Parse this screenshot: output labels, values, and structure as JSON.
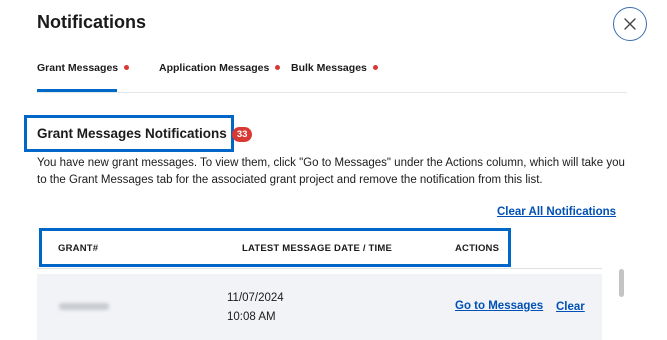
{
  "header": {
    "title": "Notifications"
  },
  "tabs": [
    {
      "label": "Grant Messages",
      "active": true
    },
    {
      "label": "Application Messages",
      "active": false
    },
    {
      "label": "Bulk Messages",
      "active": false
    }
  ],
  "section": {
    "title": "Grant Messages Notifications",
    "count": "33",
    "description": "You have new grant messages. To view them, click \"Go to Messages\" under the Actions column, which will take you to the Grant Messages tab for the associated grant project and remove the notification from this list."
  },
  "actions": {
    "clear_all_label": "Clear All Notifications"
  },
  "table": {
    "columns": [
      "GRANT#",
      "LATEST MESSAGE DATE / TIME",
      "ACTIONS"
    ],
    "rows": [
      {
        "grant": "",
        "date": "11/07/2024",
        "time": "10:08 AM",
        "go_label": "Go to Messages",
        "clear_label": "Clear"
      }
    ]
  },
  "colors": {
    "accent": "#0050b5",
    "highlight_box": "#0066c7",
    "badge": "#d83933",
    "row_bg": "#f1f3f6"
  },
  "icons": {
    "close": "close-icon (x in circle)",
    "notification_dot": "red-dot-icon"
  }
}
